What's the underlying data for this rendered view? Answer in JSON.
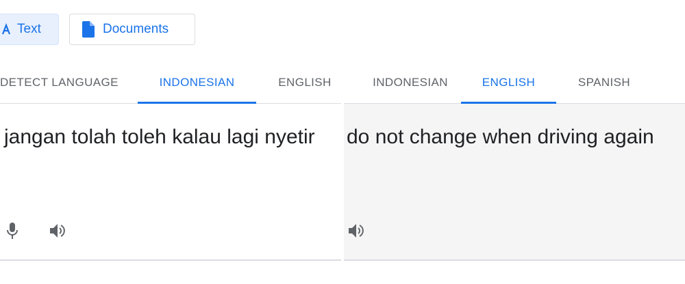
{
  "modes": {
    "text_label": "Text",
    "documents_label": "Documents"
  },
  "source": {
    "tabs": [
      {
        "label": "DETECT LANGUAGE",
        "active": false
      },
      {
        "label": "INDONESIAN",
        "active": true
      },
      {
        "label": "ENGLISH",
        "active": false
      }
    ],
    "text": "jangan tolah toleh kalau lagi nyetir"
  },
  "target": {
    "tabs": [
      {
        "label": "INDONESIAN",
        "active": false
      },
      {
        "label": "ENGLISH",
        "active": true
      },
      {
        "label": "SPANISH",
        "active": false
      }
    ],
    "text": "do not change when driving again"
  },
  "icons": {
    "text_mode": "translate-icon",
    "documents_mode": "document-icon",
    "mic": "microphone-icon",
    "speaker_source": "speaker-icon",
    "speaker_target": "speaker-icon"
  },
  "colors": {
    "accent": "#1a73e8",
    "muted": "#5f6368",
    "text": "#202124",
    "target_bg": "#f5f5f5"
  }
}
